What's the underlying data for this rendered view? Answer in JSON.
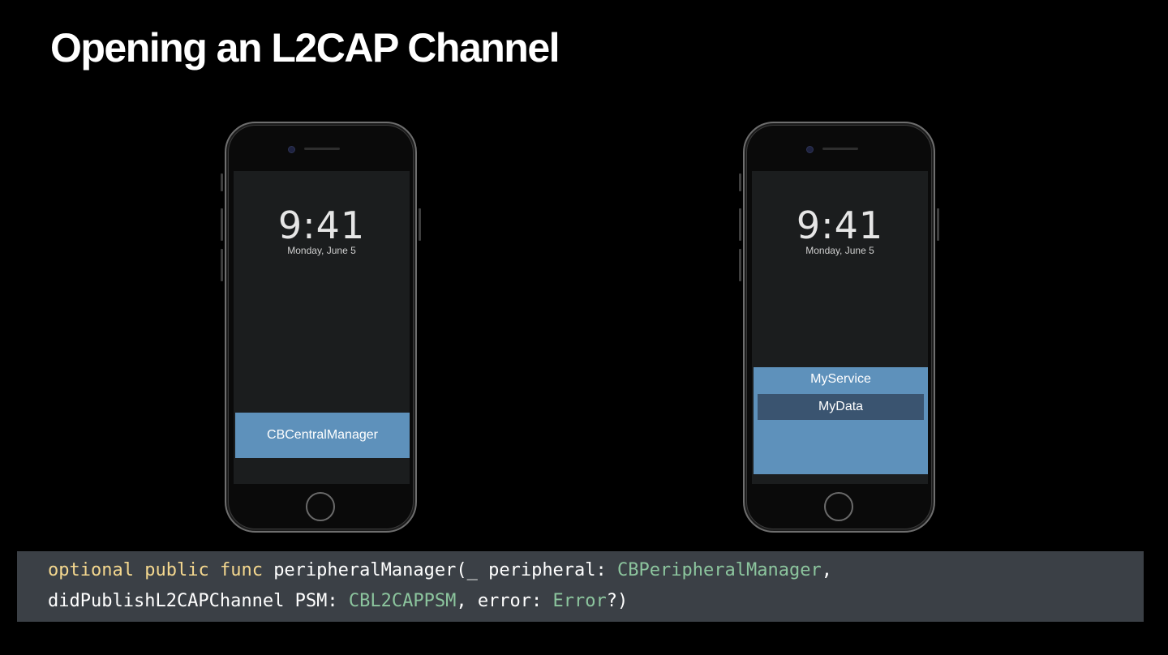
{
  "slide": {
    "title": "Opening an L2CAP Channel"
  },
  "phones": {
    "left": {
      "time": "9:41",
      "date": "Monday, June 5",
      "panel_label": "CBCentralManager"
    },
    "right": {
      "time": "9:41",
      "date": "Monday, June 5",
      "service_label": "MyService",
      "characteristic_label": "MyData"
    }
  },
  "code": {
    "line1": {
      "kw_optional": "optional",
      "kw_public": "public",
      "kw_func": "func",
      "text1": "peripheralManager(_ peripheral: ",
      "type1": "CBPeripheralManager",
      "text2": ","
    },
    "line2": {
      "text1": "didPublishL2CAPChannel PSM: ",
      "type1": "CBL2CAPPSM",
      "text2": ", error: ",
      "type2": "Error",
      "text3": "?)"
    }
  },
  "colors": {
    "background": "#000000",
    "accent_blue": "#5e91bb",
    "accent_dark_blue": "#3a5470",
    "code_panel": "#3b4046",
    "keyword": "#f5d88f",
    "type": "#8cc59e"
  }
}
